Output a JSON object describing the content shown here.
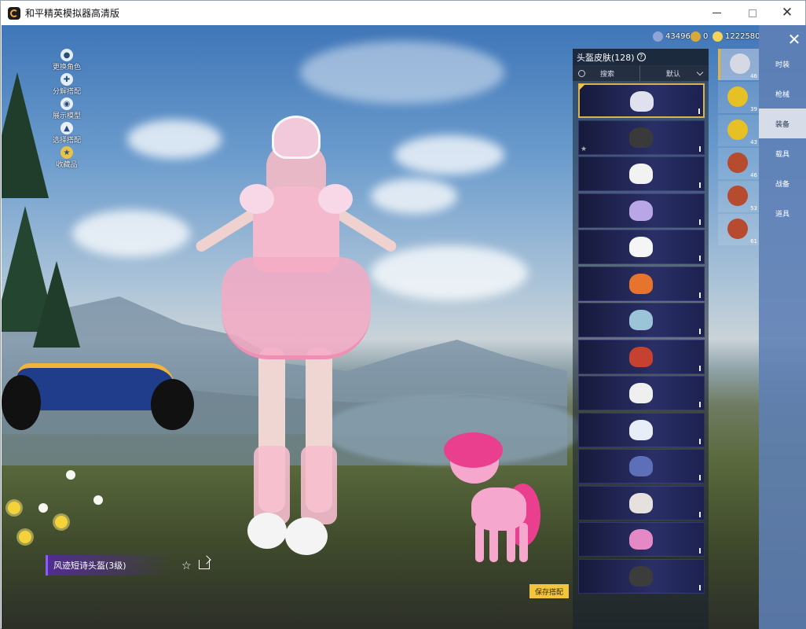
{
  "window": {
    "title": "和平精英模拟器高清版",
    "controls": {
      "minimize": "minimize-icon",
      "maximize": "maximize-icon",
      "close": "✕"
    }
  },
  "currency": [
    {
      "icon": "coin-blue-icon",
      "value": "43496",
      "color": "#8fa3d6"
    },
    {
      "icon": "coin-gold-icon",
      "value": "0",
      "color": "#d8a93a"
    },
    {
      "icon": "coupon-icon",
      "value": "1222580",
      "color": "#f3d35a"
    }
  ],
  "left_tools": [
    {
      "icon": "person-icon",
      "label": "更换角色"
    },
    {
      "icon": "puzzle-icon",
      "label": "分解搭配"
    },
    {
      "icon": "eye-icon",
      "label": "展示模型"
    },
    {
      "icon": "hanger-icon",
      "label": "选择搭配"
    },
    {
      "icon": "trophy-icon",
      "label": "收藏品"
    }
  ],
  "panel": {
    "title": "头盔皮肤(128)",
    "help": "?",
    "search_label": "搜索",
    "sort_label": "默认"
  },
  "skins": [
    {
      "color": "#dfe2ee",
      "selected": true,
      "new": true
    },
    {
      "color": "#3a3a3a",
      "starred": true
    },
    {
      "color": "#f2f2f2"
    },
    {
      "color": "#b8a6e6"
    },
    {
      "color": "#f5f5f5"
    },
    {
      "color": "#e7742d"
    },
    {
      "color": "#9bc4d8"
    },
    {
      "color": "#c64130"
    },
    {
      "color": "#efefef"
    },
    {
      "color": "#e8eef7"
    },
    {
      "color": "#5d6fb8"
    },
    {
      "color": "#e6e1df"
    },
    {
      "color": "#e589c6"
    },
    {
      "color": "#3c3c3c"
    }
  ],
  "slots": [
    {
      "icon": "helmet-icon",
      "count": "46",
      "color": "#d6d8e4",
      "active": true
    },
    {
      "icon": "helmet-yellow-icon",
      "count": "39",
      "color": "#e6c024"
    },
    {
      "icon": "helmet-yellow-icon",
      "count": "43",
      "color": "#e6c024"
    },
    {
      "icon": "backpack-red-icon",
      "count": "46",
      "color": "#b64b2f"
    },
    {
      "icon": "backpack-red-icon",
      "count": "53",
      "color": "#b64b2f"
    },
    {
      "icon": "backpack-red-icon",
      "count": "61",
      "color": "#b64b2f"
    }
  ],
  "nav": {
    "close": "✕",
    "items": [
      {
        "label": "时装"
      },
      {
        "label": "枪械"
      },
      {
        "label": "装备",
        "active": true
      },
      {
        "label": "载具"
      },
      {
        "label": "战备"
      },
      {
        "label": "道具"
      }
    ]
  },
  "bottom": {
    "item_name": "风迹短诗头盔(3级)",
    "fav": "☆",
    "save_label": "保存搭配"
  }
}
